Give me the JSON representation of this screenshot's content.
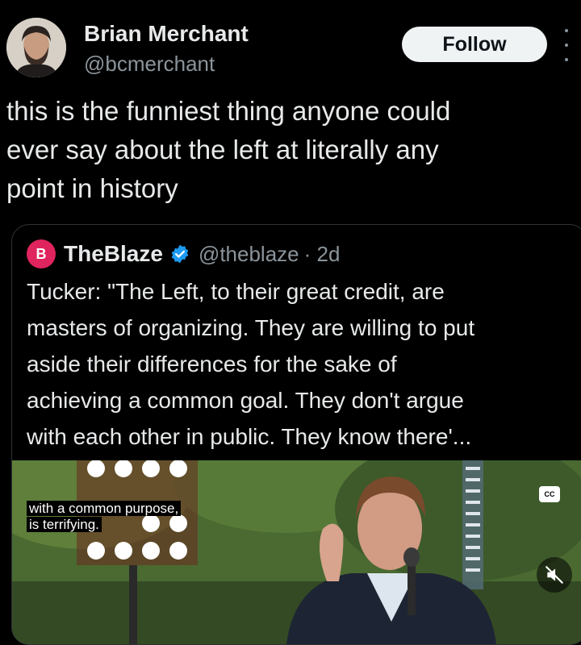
{
  "author": {
    "name": "Brian Merchant",
    "handle": "@bcmerchant",
    "avatar_icon": "avatar-portrait-icon"
  },
  "follow_label": "Follow",
  "tweet_text": "this is the funniest thing anyone could\never say about the left at literally any\npoint in history",
  "quoted": {
    "name": "TheBlaze",
    "handle": "@theblaze",
    "time": "· 2d",
    "logo_letter": "B",
    "text": "Tucker: \"The Left, to their great credit, are\nmasters of organizing. They are willing to put\naside their differences for the sake of\nachieving a common goal. They don't argue\nwith each other in public. They know there'...",
    "video_caption": [
      "with a common purpose,",
      "is terrifying."
    ],
    "cc_label": "CC"
  },
  "colors": {
    "background": "#000000",
    "text": "#e7e9ea",
    "secondary_text": "#8b949b",
    "follow_bg": "#eff3f4",
    "verified_blue": "#1d9bf0",
    "blaze_red": "#e0245e"
  }
}
